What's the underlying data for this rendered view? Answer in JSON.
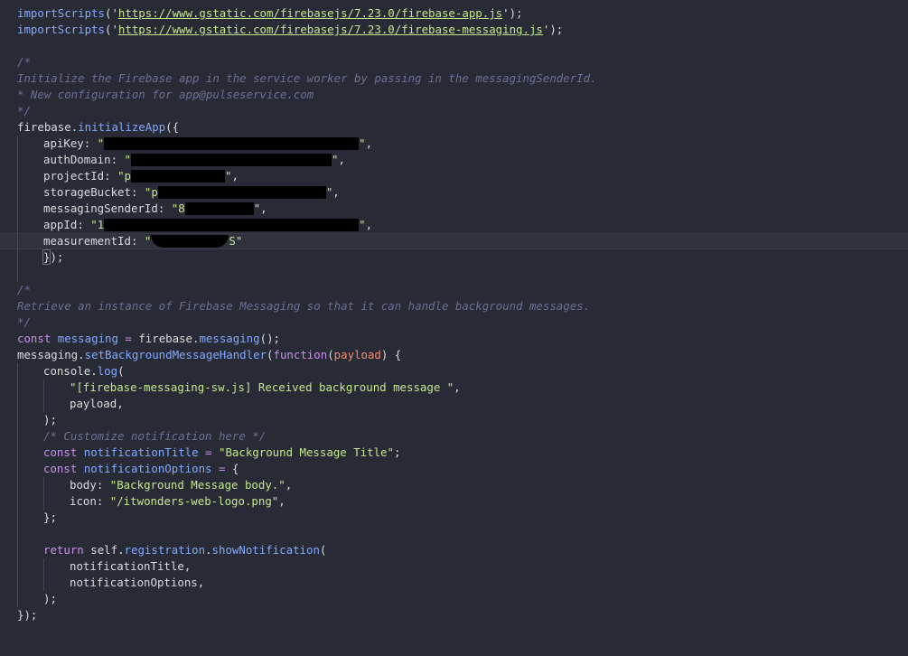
{
  "editor": {
    "background": "#282a36",
    "colors": {
      "function": "#82aaff",
      "string": "#c3e88d",
      "comment": "#6b7194",
      "keyword": "#c792ea",
      "parameter": "#f78c6c",
      "text": "#dcdcdc"
    },
    "import_fn": "importScripts",
    "import_url_app": "https://www.gstatic.com/firebasejs/7.23.0/firebase-app.js",
    "import_url_messaging": "https://www.gstatic.com/firebasejs/7.23.0/firebase-messaging.js",
    "comment_open": "/*",
    "comment_close": "*/",
    "comment1_line1": "Initialize the Firebase app in the service worker by passing in the messagingSenderId.",
    "comment1_line2": "* New configuration for app@pulseservice.com",
    "firebase_obj": "firebase",
    "initialize_app": "initializeApp",
    "config": {
      "apiKey_label": "apiKey",
      "apiKey_visible": "",
      "authDomain_label": "authDomain",
      "authDomain_visible": "",
      "projectId_label": "projectId",
      "projectId_visible": "p",
      "storageBucket_label": "storageBucket",
      "storageBucket_visible": "p",
      "messagingSenderId_label": "messagingSenderId",
      "messagingSenderId_visible": "8",
      "appId_label": "appId",
      "appId_visible": "1",
      "measurementId_label": "measurementId",
      "measurementId_visible_end": "S"
    },
    "comment2_line1": "Retrieve an instance of Firebase Messaging so that it can handle background messages.",
    "const_kw": "const",
    "messaging_var": "messaging",
    "messaging_fn": "messaging",
    "set_handler_fn": "setBackgroundMessageHandler",
    "function_kw": "function",
    "payload_param": "payload",
    "console_obj": "console",
    "log_fn": "log",
    "log_message": "\"[firebase-messaging-sw.js] Received background message \"",
    "payload_arg": "payload",
    "customize_comment": "/* Customize notification here */",
    "notification_title_var": "notificationTitle",
    "notification_title_value": "\"Background Message Title\"",
    "notification_options_var": "notificationOptions",
    "body_key": "body",
    "body_value": "\"Background Message body.\"",
    "icon_key": "icon",
    "icon_value": "\"/itwonders-web-logo.png\"",
    "return_kw": "return",
    "self_obj": "self",
    "registration_prop": "registration",
    "show_notification_fn": "showNotification",
    "arg_title": "notificationTitle",
    "arg_options": "notificationOptions"
  }
}
